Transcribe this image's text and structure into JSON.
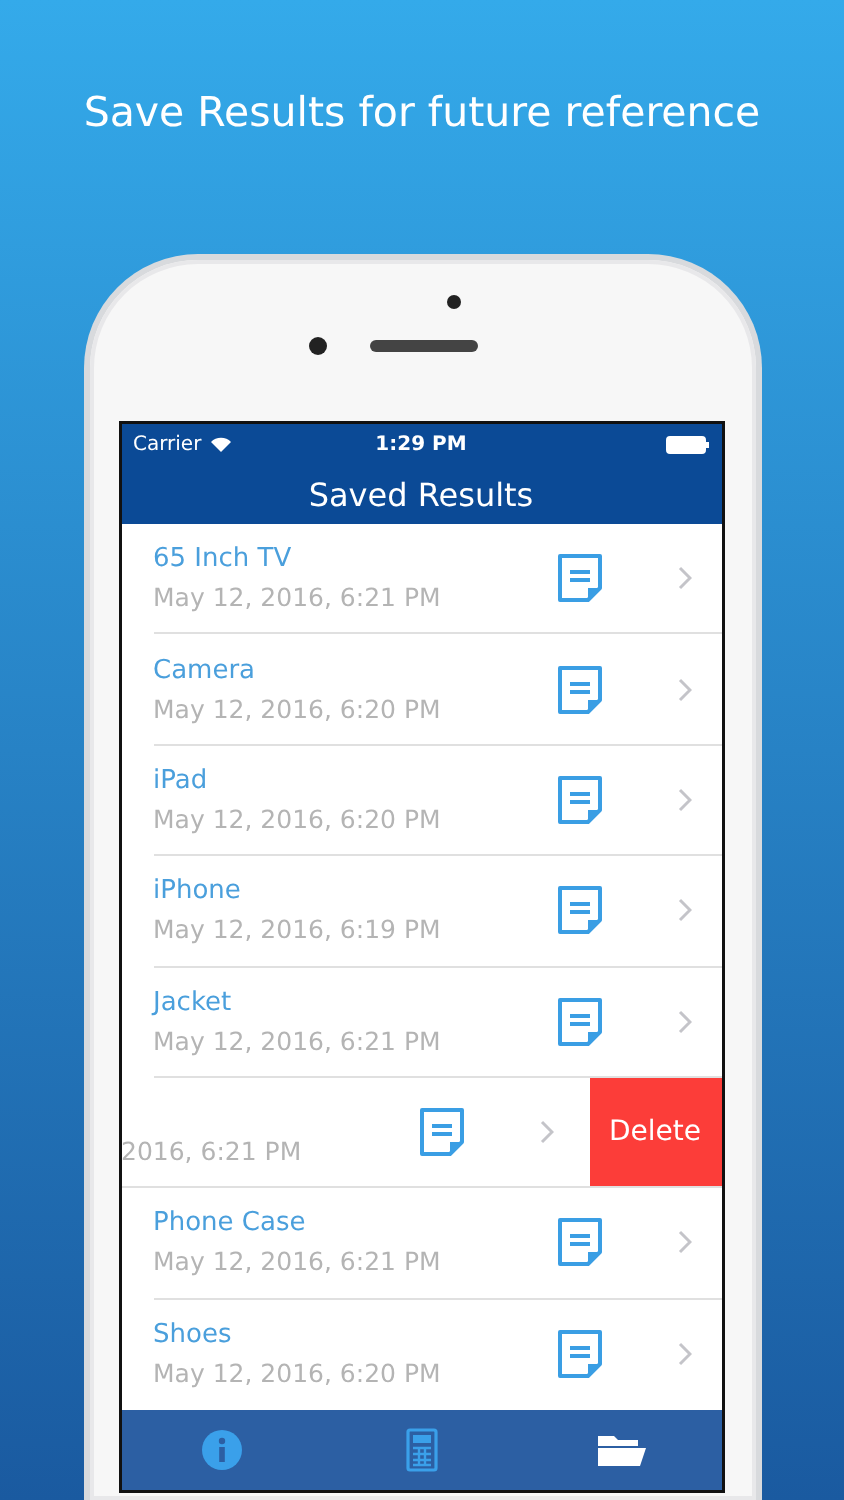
{
  "headline": "Save Results for future reference",
  "status_bar": {
    "carrier": "Carrier",
    "time": "1:29 PM"
  },
  "nav_bar": {
    "title": "Saved Results"
  },
  "rows": [
    {
      "kind": "normal",
      "name": "65 Inch TV",
      "date": "May 12, 2016, 6:21 PM"
    },
    {
      "kind": "normal",
      "name": "Camera",
      "date": "May 12, 2016, 6:20 PM"
    },
    {
      "kind": "normal",
      "name": "iPad",
      "date": "May 12, 2016, 6:20 PM"
    },
    {
      "kind": "normal",
      "name": "iPhone",
      "date": "May 12, 2016, 6:19 PM"
    },
    {
      "kind": "normal",
      "name": "Jacket",
      "date": "May 12, 2016, 6:21 PM"
    },
    {
      "kind": "swiped",
      "date": "2016, 6:21 PM",
      "action": "Delete"
    },
    {
      "kind": "normal",
      "name": "Phone Case",
      "date": "May 12, 2016, 6:21 PM"
    },
    {
      "kind": "normal",
      "name": "Shoes",
      "date": "May 12, 2016, 6:20 PM"
    }
  ],
  "tab_bar": [
    {
      "kind": "info",
      "selected": false
    },
    {
      "kind": "calculator",
      "selected": false
    },
    {
      "kind": "folder",
      "selected": true
    }
  ]
}
